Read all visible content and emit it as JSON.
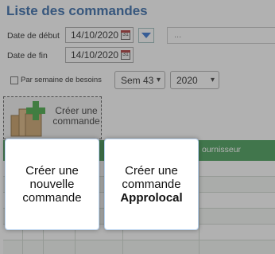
{
  "page": {
    "title": "Liste des commandes",
    "start_date_label": "Date de début",
    "start_date_value": "14/10/2020",
    "end_date_label": "Date de fin",
    "end_date_value": "14/10/2020",
    "search_placeholder": "...",
    "week_checkbox_label": "Par semaine de besoins",
    "week_select_value": "Sem 43",
    "year_select_value": "2020",
    "calendar_icon_text": "31",
    "create_button_line1": "Créer une",
    "create_button_line2": "commande",
    "grid_header_partial": "ournisseur"
  },
  "modal": {
    "option1": {
      "line1": "Créer une",
      "line2": "nouvelle",
      "line3": "commande"
    },
    "option2": {
      "line1": "Créer une",
      "line2": "commande",
      "line3": "Approlocal"
    }
  },
  "colors": {
    "title": "#2e64a6",
    "grid_header": "#3f9a52",
    "overlay": "rgba(70,70,70,0.42)",
    "dropdown_arrow": "#2e6fd0"
  },
  "icons": [
    "calendar-icon",
    "dropdown-arrow-icon",
    "boxes-add-icon",
    "chevron-down-icon"
  ]
}
